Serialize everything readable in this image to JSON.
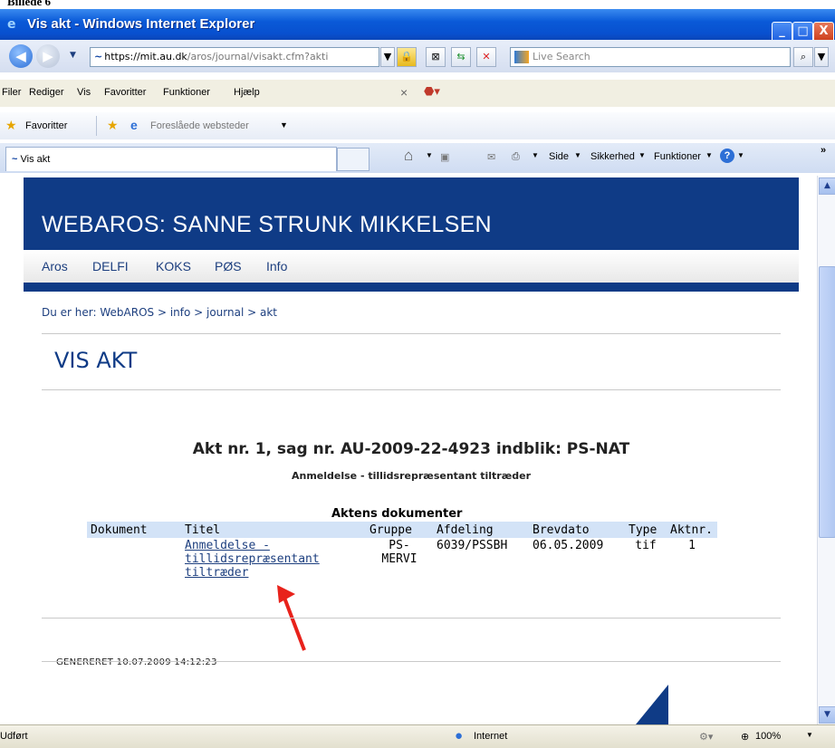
{
  "document_caption": "Billede 6",
  "window": {
    "title": "Vis akt - Windows Internet Explorer",
    "minimize": "_",
    "maximize": "□",
    "close": "X"
  },
  "address": {
    "scheme_host": "https://mit.au.dk",
    "path": "/aros/journal/visakt.cfm?akti"
  },
  "search": {
    "placeholder": "Live Search"
  },
  "menu": [
    "Filer",
    "Rediger",
    "Vis",
    "Favoritter",
    "Funktioner",
    "Hjælp"
  ],
  "favorites": {
    "label": "Favoritter",
    "suggested": "Foreslåede websteder"
  },
  "tab": {
    "label": "Vis akt"
  },
  "command_bar": {
    "page": "Side",
    "safety": "Sikkerhed",
    "tools": "Funktioner",
    "more": "»"
  },
  "page": {
    "banner_title": "WEBAROS: SANNE STRUNK MIKKELSEN",
    "nav": [
      "Aros",
      "DELFI",
      "KOKS",
      "PØS",
      "Info"
    ],
    "breadcrumb": "Du er her:  WebAROS > info > journal > akt",
    "title": "VIS AKT",
    "heading": "Akt nr. 1, sag nr. AU-2009-22-4923 indblik: PS-NAT",
    "subheading": "Anmeldelse - tillidsrepræsentant tiltræder",
    "table_caption": "Aktens dokumenter",
    "columns": [
      "Dokument",
      "Titel",
      "Gruppe",
      "Afdeling",
      "Brevdato",
      "Type",
      "Aktnr."
    ],
    "row": {
      "dokument": "",
      "titel_lines": [
        "Anmeldelse -",
        "tillidsrepræsentant",
        "tiltræder"
      ],
      "gruppe_lines": [
        "PS-",
        "MERVI"
      ],
      "afdeling": "6039/PSSBH",
      "brevdato": "06.05.2009",
      "type": "tif",
      "aktnr": "1"
    },
    "generated": "GENERERET 10.07.2009 14:12:23"
  },
  "status": {
    "text": "Udført",
    "zone": "Internet",
    "zoom": "100%"
  },
  "colors": {
    "banner": "#0f3b86",
    "link": "#1d3f7f",
    "header_row": "#d3e3f7",
    "arrow": "#e8221b"
  }
}
